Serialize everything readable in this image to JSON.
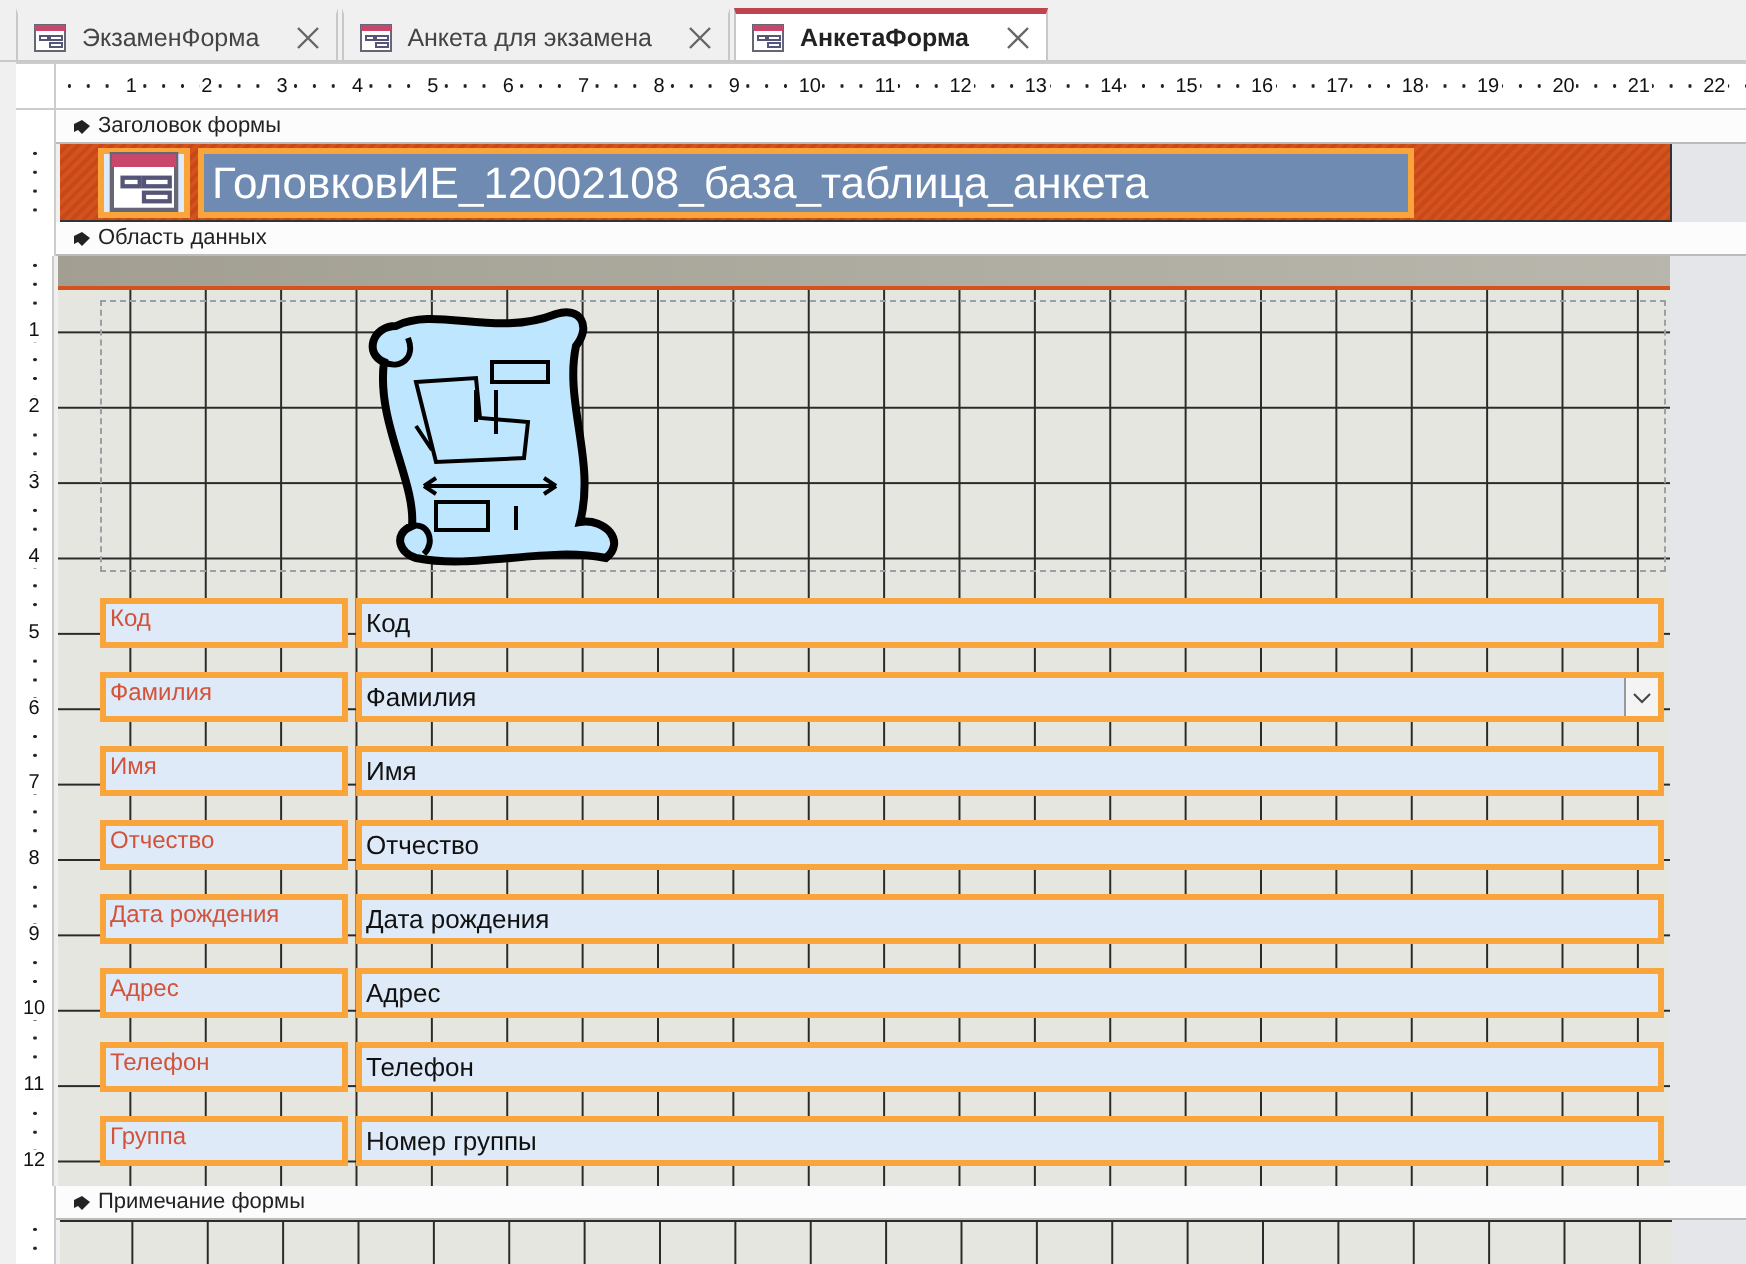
{
  "tabs": [
    {
      "label": "ЭкзаменФорма",
      "selected": false
    },
    {
      "label": "Анкета для экзамена",
      "selected": false
    },
    {
      "label": "АнкетаФорма",
      "selected": true
    }
  ],
  "ruler": {
    "horizontal": [
      "1",
      "2",
      "3",
      "4",
      "5",
      "6",
      "7",
      "8",
      "9",
      "10",
      "11",
      "12",
      "13",
      "14",
      "15",
      "16",
      "17",
      "18",
      "19",
      "20",
      "21",
      "22"
    ],
    "vertical": [
      "1",
      "2",
      "3",
      "4",
      "5",
      "6",
      "7",
      "8",
      "9",
      "10",
      "11",
      "12"
    ]
  },
  "sections": [
    {
      "kind": "header",
      "title": "Заголовок формы",
      "form_title": "ГоловковИЕ_12002108_база_таблица_анкета"
    },
    {
      "kind": "detail",
      "title": "Область данных",
      "fields": [
        {
          "label": "Код",
          "value": "Код",
          "kind": "text"
        },
        {
          "label": "Фамилия",
          "value": "Фамилия",
          "kind": "combo"
        },
        {
          "label": "Имя",
          "value": "Имя",
          "kind": "text"
        },
        {
          "label": "Отчество",
          "value": "Отчество",
          "kind": "text"
        },
        {
          "label": "Дата рождения",
          "value": "Дата рождения",
          "kind": "text"
        },
        {
          "label": "Адрес",
          "value": "Адрес",
          "kind": "text"
        },
        {
          "label": "Телефон",
          "value": "Телефон",
          "kind": "text"
        },
        {
          "label": "Группа",
          "value": "Номер группы",
          "kind": "text"
        }
      ]
    },
    {
      "kind": "footer",
      "title": "Примечание формы"
    }
  ]
}
